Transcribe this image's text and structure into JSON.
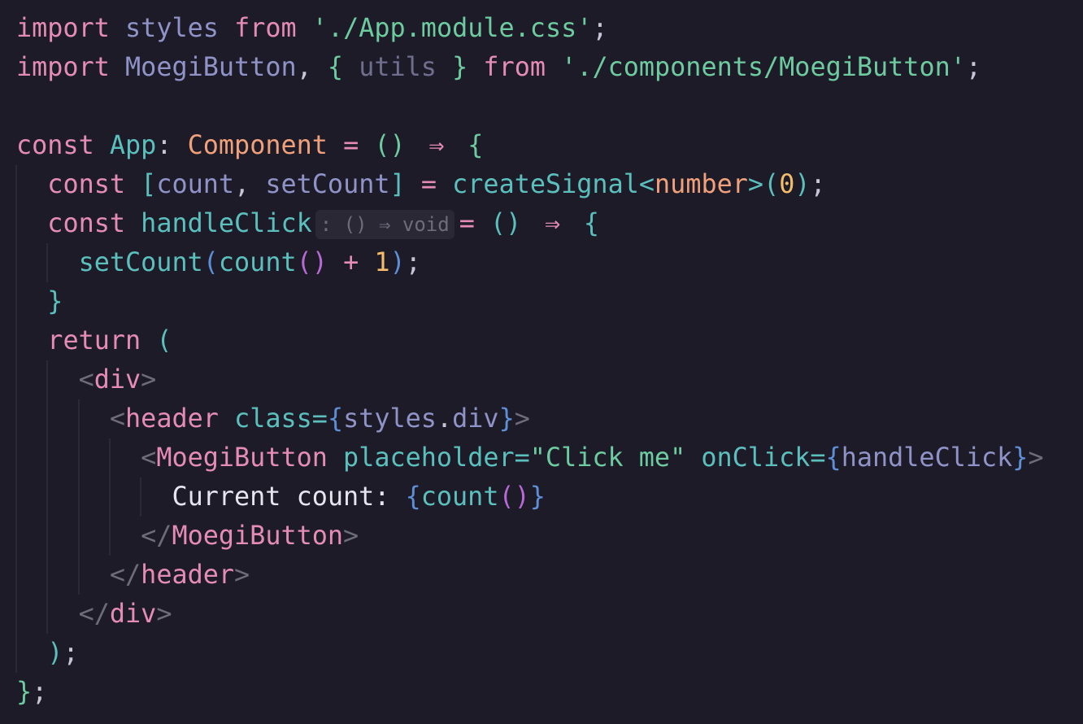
{
  "colors": {
    "background": "#1d1b27",
    "kw": "#e58cb5",
    "var": "#8f93c8",
    "dim": "#6f6e8e",
    "str": "#6dcb9f",
    "punct": "#c8c6d6",
    "fn": "#5bc0bd",
    "type": "#f0a07a",
    "num": "#f4bd6b",
    "tagb": "#6e6c7a",
    "attr": "#5bc0bd",
    "jsx": "#5e8fd6",
    "paren": "#b76ad6",
    "text": "#e6e4ef",
    "op": "#e58cb5"
  },
  "lines": [
    [
      [
        "import",
        "kw"
      ],
      [
        " "
      ],
      [
        "styles",
        "var"
      ],
      [
        " "
      ],
      [
        "from",
        "kw"
      ],
      [
        " "
      ],
      [
        "'./App.module.css'",
        "str"
      ],
      [
        ";",
        "punct"
      ]
    ],
    [
      [
        "import",
        "kw"
      ],
      [
        " "
      ],
      [
        "MoegiButton",
        "var"
      ],
      [
        ",",
        "punct"
      ],
      [
        " "
      ],
      [
        "{",
        "str"
      ],
      [
        " "
      ],
      [
        "utils",
        "dim"
      ],
      [
        " "
      ],
      [
        "}",
        "str"
      ],
      [
        " "
      ],
      [
        "from",
        "kw"
      ],
      [
        " "
      ],
      [
        "'./components/MoegiButton'",
        "str"
      ],
      [
        ";",
        "punct"
      ]
    ],
    [],
    [
      [
        "const",
        "kw"
      ],
      [
        " "
      ],
      [
        "App",
        "fn"
      ],
      [
        ":",
        "punct"
      ],
      [
        " "
      ],
      [
        "Component",
        "type"
      ],
      [
        " "
      ],
      [
        "=",
        "op"
      ],
      [
        " "
      ],
      [
        "()",
        "str"
      ],
      [
        " "
      ],
      [
        "⇒",
        "op",
        "lig"
      ],
      [
        " "
      ],
      [
        "{",
        "str"
      ]
    ],
    [
      [
        "  "
      ],
      [
        "const",
        "kw"
      ],
      [
        " "
      ],
      [
        "[",
        "fn"
      ],
      [
        "count",
        "var"
      ],
      [
        ",",
        "punct"
      ],
      [
        " "
      ],
      [
        "setCount",
        "var"
      ],
      [
        "]",
        "fn"
      ],
      [
        " "
      ],
      [
        "=",
        "op"
      ],
      [
        " "
      ],
      [
        "createSignal",
        "fn"
      ],
      [
        "<",
        "fn"
      ],
      [
        "number",
        "type"
      ],
      [
        ">",
        "fn"
      ],
      [
        "(",
        "fn"
      ],
      [
        "0",
        "num"
      ],
      [
        ")",
        "fn"
      ],
      [
        ";",
        "punct"
      ]
    ],
    [
      [
        "  "
      ],
      [
        "const",
        "kw"
      ],
      [
        " "
      ],
      [
        "handleClick",
        "fn"
      ],
      [
        ": () ⇒ void",
        "hint",
        "hint"
      ],
      [
        "=",
        "op"
      ],
      [
        " "
      ],
      [
        "()",
        "fn"
      ],
      [
        " "
      ],
      [
        "⇒",
        "op",
        "lig"
      ],
      [
        " "
      ],
      [
        "{",
        "fn"
      ]
    ],
    [
      [
        "    "
      ],
      [
        "setCount",
        "fn"
      ],
      [
        "(",
        "jsx"
      ],
      [
        "count",
        "fn"
      ],
      [
        "()",
        "paren"
      ],
      [
        " "
      ],
      [
        "+",
        "op"
      ],
      [
        " "
      ],
      [
        "1",
        "num"
      ],
      [
        ")",
        "jsx"
      ],
      [
        ";",
        "punct"
      ]
    ],
    [
      [
        "  "
      ],
      [
        "}",
        "fn"
      ]
    ],
    [
      [
        "  "
      ],
      [
        "return",
        "kw"
      ],
      [
        " "
      ],
      [
        "(",
        "fn"
      ]
    ],
    [
      [
        "    "
      ],
      [
        "<",
        "tagb"
      ],
      [
        "div",
        "kw"
      ],
      [
        ">",
        "tagb"
      ]
    ],
    [
      [
        "      "
      ],
      [
        "<",
        "tagb"
      ],
      [
        "header",
        "kw"
      ],
      [
        " "
      ],
      [
        "class",
        "attr"
      ],
      [
        "=",
        "attr"
      ],
      [
        "{",
        "jsx"
      ],
      [
        "styles",
        "var"
      ],
      [
        ".",
        "punct"
      ],
      [
        "div",
        "var"
      ],
      [
        "}",
        "jsx"
      ],
      [
        ">",
        "tagb"
      ]
    ],
    [
      [
        "        "
      ],
      [
        "<",
        "tagb"
      ],
      [
        "MoegiButton",
        "kw"
      ],
      [
        " "
      ],
      [
        "placeholder",
        "attr"
      ],
      [
        "=",
        "attr"
      ],
      [
        "\"Click me\"",
        "str"
      ],
      [
        " "
      ],
      [
        "onClick",
        "attr"
      ],
      [
        "=",
        "attr"
      ],
      [
        "{",
        "jsx"
      ],
      [
        "handleClick",
        "var"
      ],
      [
        "}",
        "jsx"
      ],
      [
        ">",
        "tagb"
      ]
    ],
    [
      [
        "          "
      ],
      [
        "Current count: ",
        "text"
      ],
      [
        "{",
        "jsx"
      ],
      [
        "count",
        "fn"
      ],
      [
        "()",
        "paren"
      ],
      [
        "}",
        "jsx"
      ]
    ],
    [
      [
        "        "
      ],
      [
        "</",
        "tagb"
      ],
      [
        "MoegiButton",
        "kw"
      ],
      [
        ">",
        "tagb"
      ]
    ],
    [
      [
        "      "
      ],
      [
        "</",
        "tagb"
      ],
      [
        "header",
        "kw"
      ],
      [
        ">",
        "tagb"
      ]
    ],
    [
      [
        "    "
      ],
      [
        "</",
        "tagb"
      ],
      [
        "div",
        "kw"
      ],
      [
        ">",
        "tagb"
      ]
    ],
    [
      [
        "  "
      ],
      [
        ")",
        "fn"
      ],
      [
        ";",
        "punct"
      ]
    ],
    [
      [
        "}",
        "str"
      ],
      [
        ";",
        "punct"
      ]
    ]
  ]
}
